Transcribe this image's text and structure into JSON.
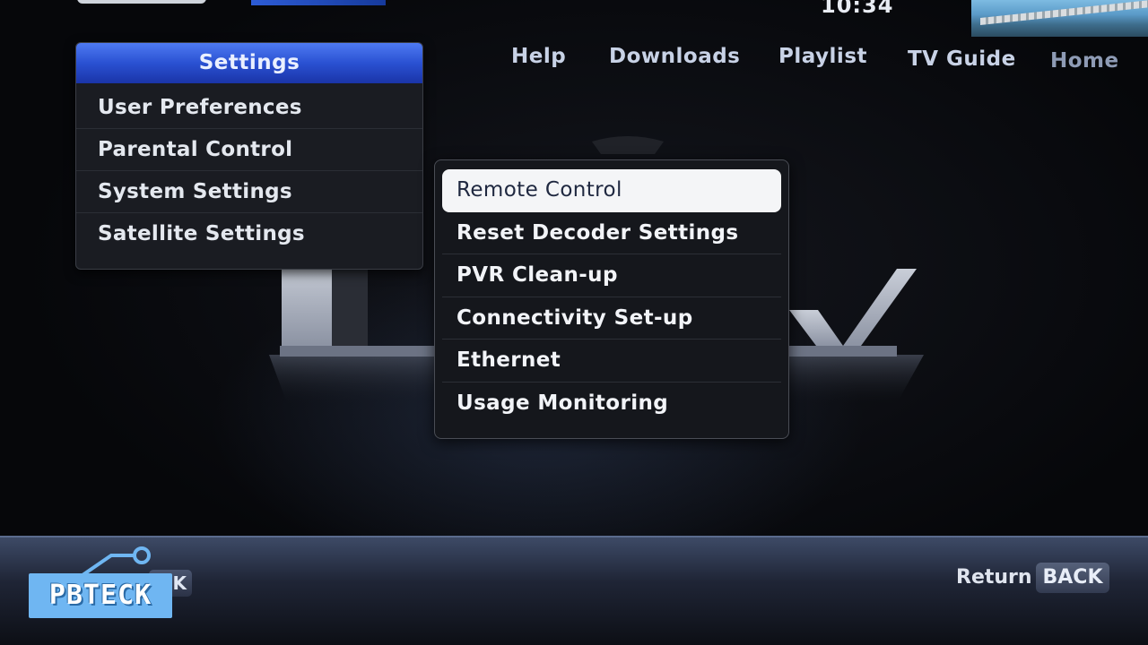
{
  "clock": "10:34",
  "nav": {
    "items": [
      "Help",
      "Downloads",
      "Playlist",
      "TV Guide",
      "Home"
    ]
  },
  "settings": {
    "title": "Settings",
    "items": [
      "User Preferences",
      "Parental Control",
      "System Settings",
      "Satellite Settings"
    ]
  },
  "submenu": {
    "items": [
      "Remote Control",
      "Reset Decoder Settings",
      "PVR Clean-up",
      "Connectivity Set-up",
      "Ethernet",
      "Usage Monitoring"
    ],
    "selected_index": 0
  },
  "footer": {
    "ok_key": "K",
    "return_label": "Return",
    "back_key": "BACK"
  },
  "watermark": {
    "text": "PBTECK"
  },
  "colors": {
    "header_blue": "#2a51d2",
    "selected_bg": "#f4f5f7",
    "panel_bg": "#15171c"
  }
}
